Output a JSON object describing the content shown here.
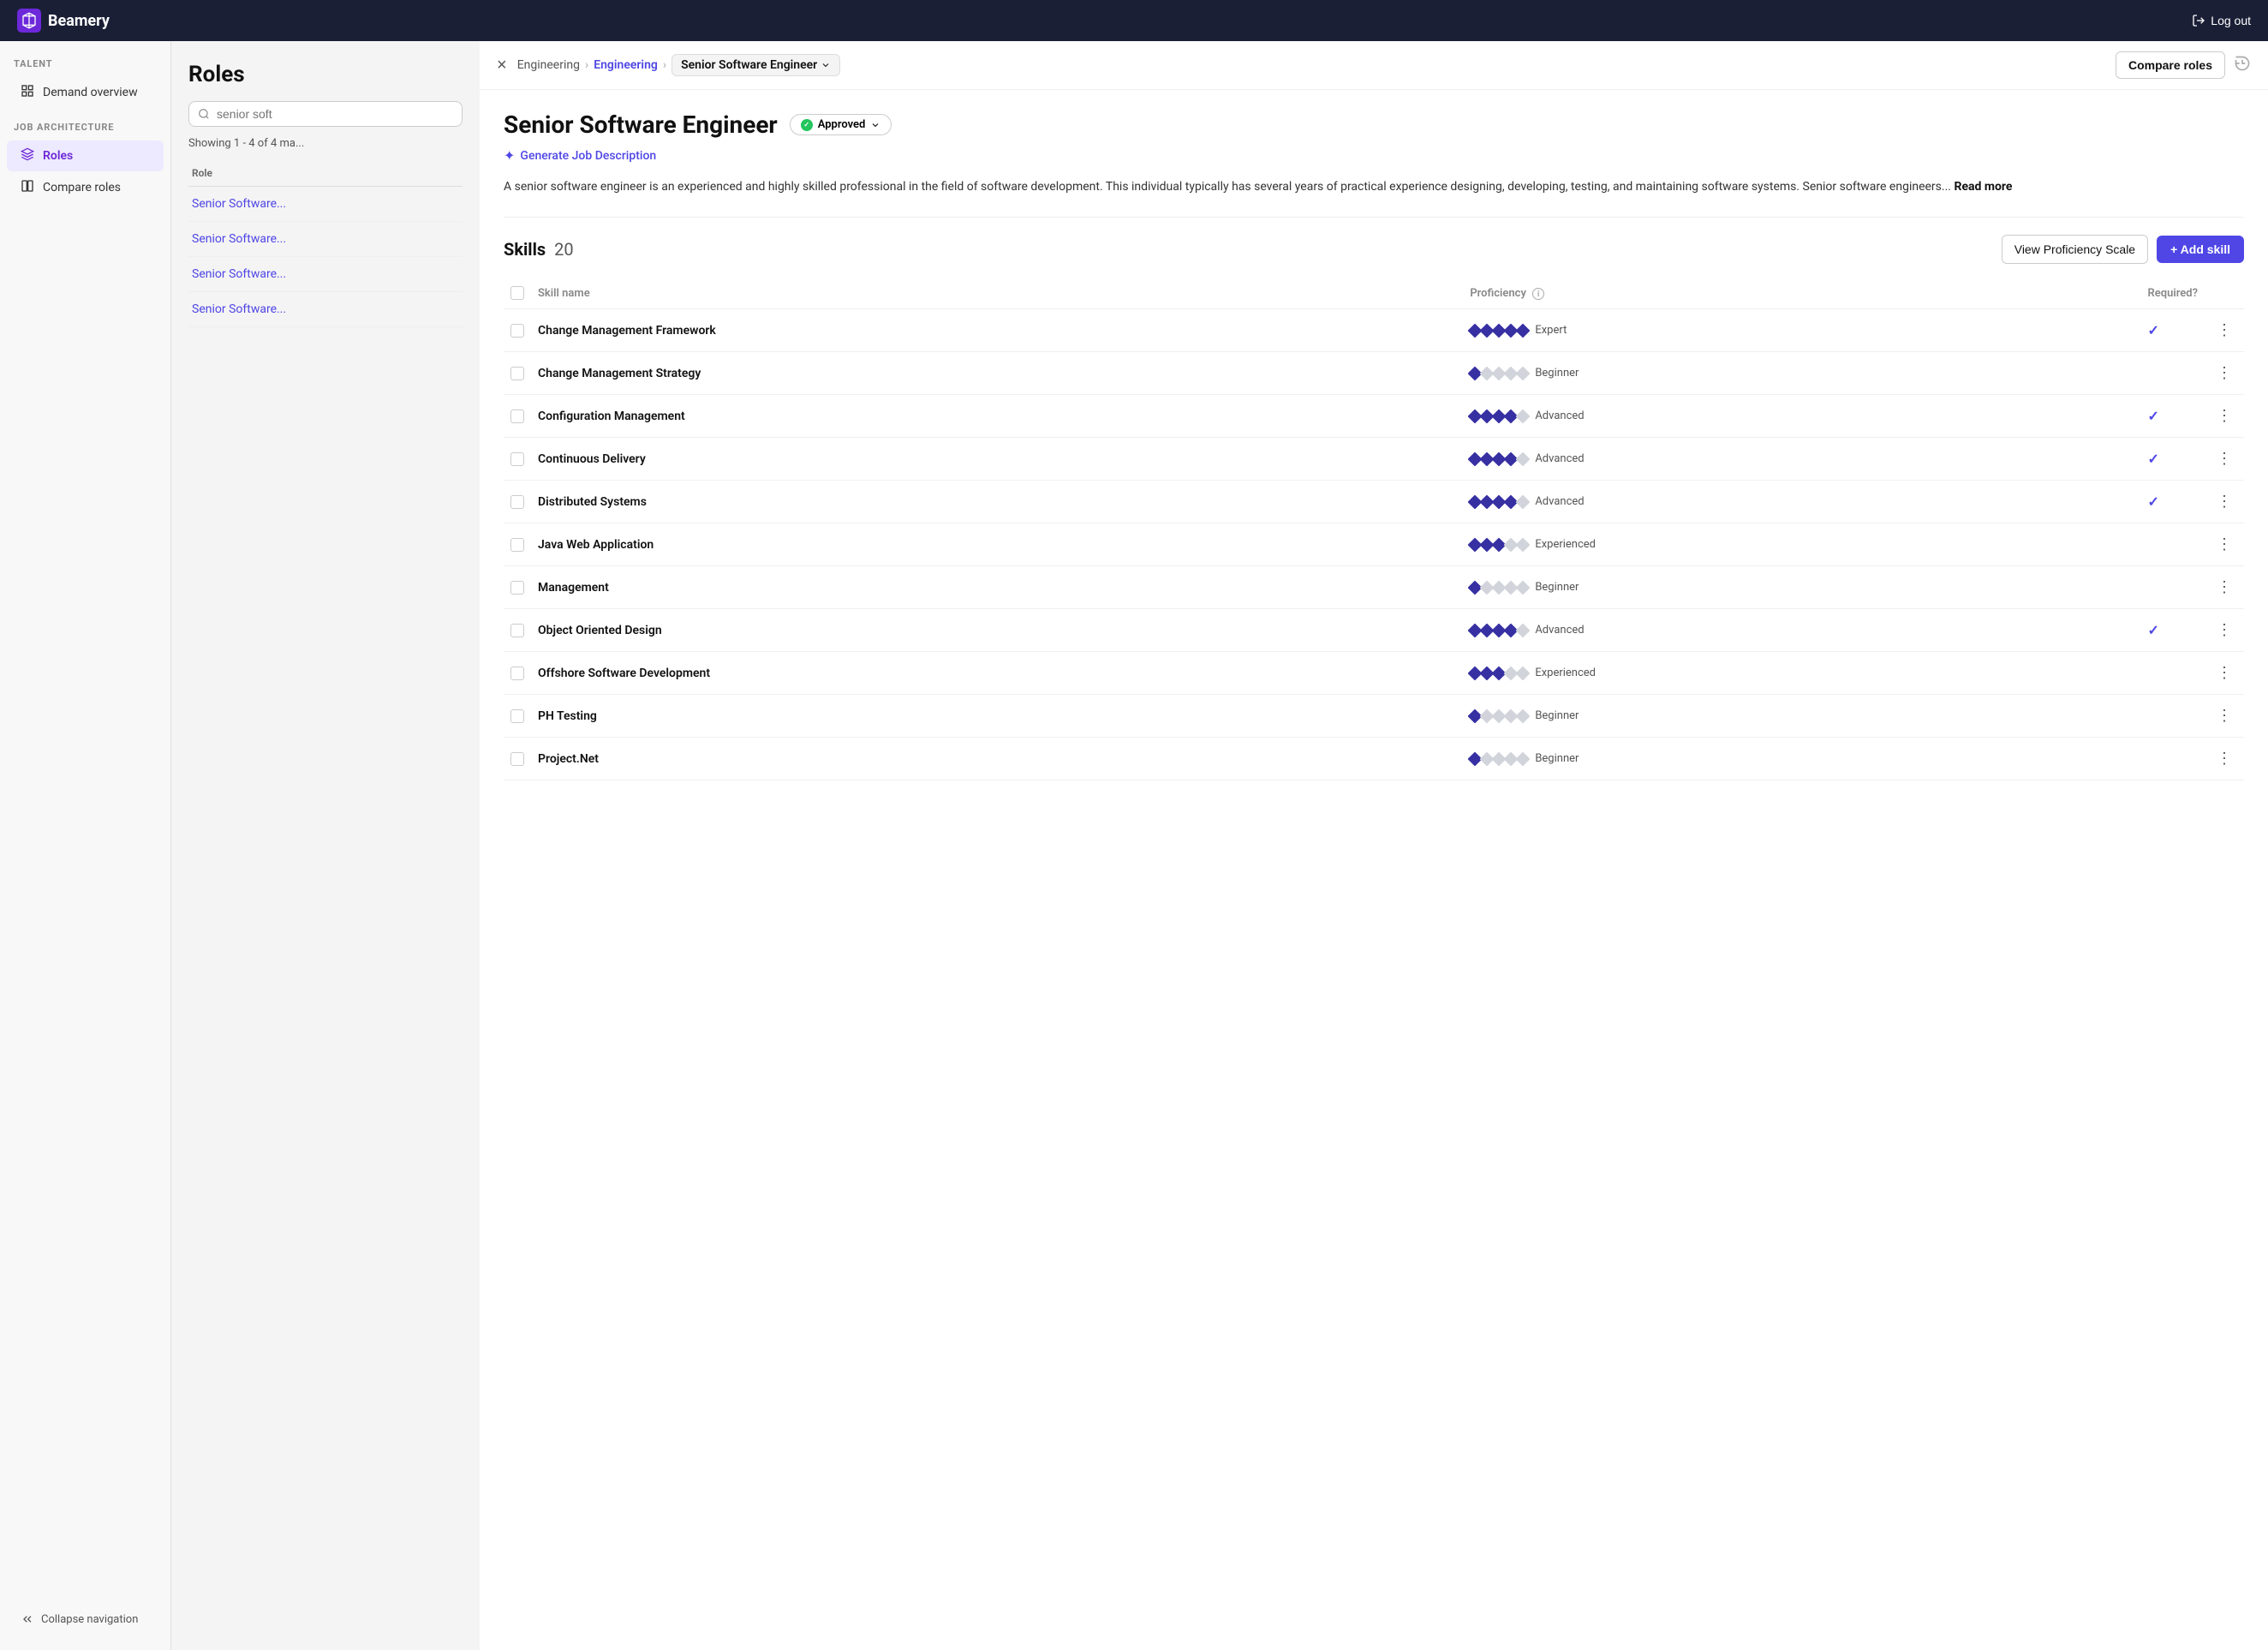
{
  "nav": {
    "brand": "Beamery",
    "logout_label": "Log out"
  },
  "sidebar": {
    "talent_label": "TALENT",
    "demand_overview": "Demand overview",
    "job_arch_label": "JOB ARCHITECTURE",
    "roles": "Roles",
    "compare_roles": "Compare roles",
    "collapse_nav": "Collapse navigation"
  },
  "roles_panel": {
    "title": "Roles",
    "search_placeholder": "senior soft",
    "showing_text": "Showing 1 - 4 of 4 ma...",
    "column_header": "Role",
    "rows": [
      "Senior Software...",
      "Senior Software...",
      "Senior Software...",
      "Senior Software..."
    ]
  },
  "detail": {
    "breadcrumb_1": "Engineering",
    "breadcrumb_2": "Engineering",
    "breadcrumb_3": "Senior Software Engineer",
    "compare_roles_btn": "Compare roles",
    "role_title": "Senior Software Engineer",
    "status": "Approved",
    "gen_job_desc": "Generate Job Description",
    "description": "A senior software engineer is an experienced and highly skilled professional in the field of software development. This individual typically has several years of practical experience designing, developing, testing, and maintaining software systems. Senior software engineers...",
    "read_more": "Read more",
    "skills_label": "Skills",
    "skills_count": "20",
    "view_proficiency_btn": "View Proficiency Scale",
    "add_skill_btn": "+ Add skill",
    "table": {
      "col_skill": "Skill name",
      "col_proficiency": "Proficiency",
      "col_required": "Required?",
      "rows": [
        {
          "name": "Change Management Framework",
          "diamonds": [
            1,
            1,
            1,
            1,
            1
          ],
          "proficiency": "Expert",
          "required": true
        },
        {
          "name": "Change Management Strategy",
          "diamonds": [
            1,
            0,
            0,
            0,
            0
          ],
          "proficiency": "Beginner",
          "required": false
        },
        {
          "name": "Configuration Management",
          "diamonds": [
            1,
            1,
            1,
            1,
            0
          ],
          "proficiency": "Advanced",
          "required": true
        },
        {
          "name": "Continuous Delivery",
          "diamonds": [
            1,
            1,
            1,
            1,
            0
          ],
          "proficiency": "Advanced",
          "required": true
        },
        {
          "name": "Distributed Systems",
          "diamonds": [
            1,
            1,
            1,
            1,
            0
          ],
          "proficiency": "Advanced",
          "required": true
        },
        {
          "name": "Java Web Application",
          "diamonds": [
            1,
            1,
            1,
            0,
            0
          ],
          "proficiency": "Experienced",
          "required": false
        },
        {
          "name": "Management",
          "diamonds": [
            1,
            0,
            0,
            0,
            0
          ],
          "proficiency": "Beginner",
          "required": false
        },
        {
          "name": "Object Oriented Design",
          "diamonds": [
            1,
            1,
            1,
            1,
            0
          ],
          "proficiency": "Advanced",
          "required": true
        },
        {
          "name": "Offshore Software Development",
          "diamonds": [
            1,
            1,
            1,
            0,
            0
          ],
          "proficiency": "Experienced",
          "required": false
        },
        {
          "name": "PH Testing",
          "diamonds": [
            1,
            0,
            0,
            0,
            0
          ],
          "proficiency": "Beginner",
          "required": false
        },
        {
          "name": "Project.Net",
          "diamonds": [
            1,
            0,
            0,
            0,
            0
          ],
          "proficiency": "Beginner",
          "required": false
        }
      ]
    }
  }
}
